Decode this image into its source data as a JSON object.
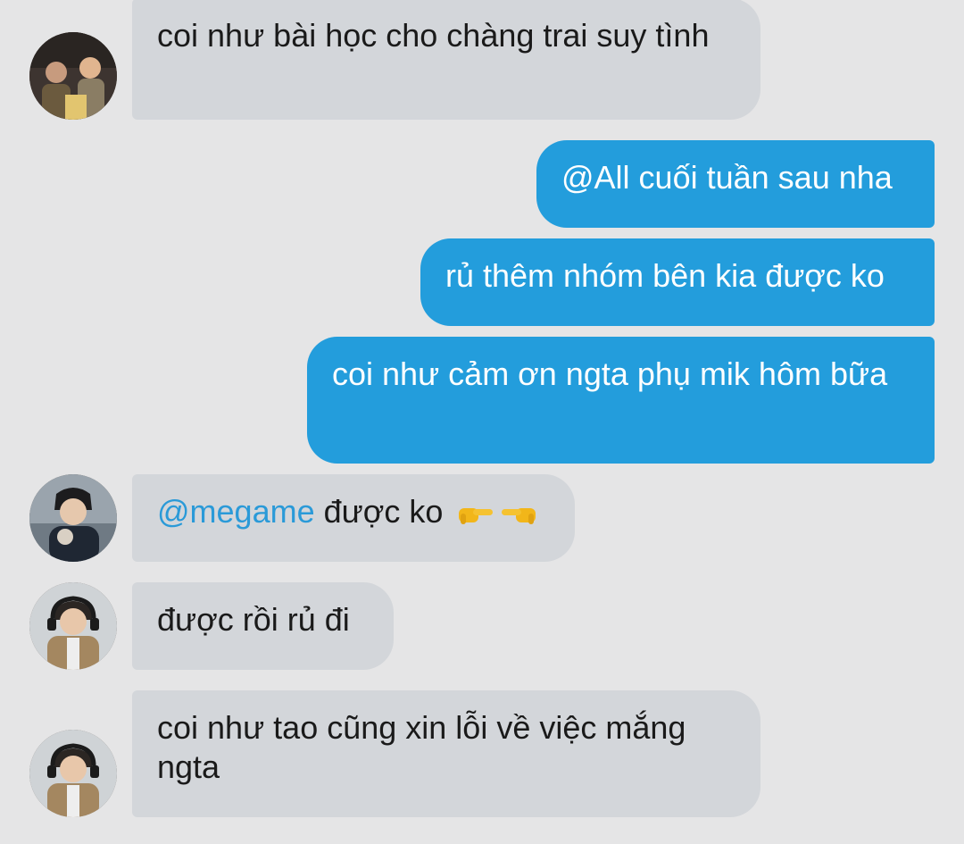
{
  "colors": {
    "background": "#e5e5e6",
    "incoming_bubble": "#d3d6da",
    "outgoing_bubble": "#239ddc",
    "mention": "#2a9ad8"
  },
  "messages": [
    {
      "direction": "incoming",
      "avatar": "avatar-1",
      "text": "coi như bài học cho chàng trai suy tình"
    },
    {
      "direction": "outgoing",
      "text": "@All cuối tuần sau nha"
    },
    {
      "direction": "outgoing",
      "text": "rủ thêm nhóm bên kia được ko"
    },
    {
      "direction": "outgoing",
      "text": "coi như cảm ơn ngta phụ mik hôm bữa"
    },
    {
      "direction": "incoming",
      "avatar": "avatar-2",
      "mention": "@megame",
      "text": " được ko",
      "emoji": [
        "pointing-right-emoji",
        "pointing-left-emoji"
      ]
    },
    {
      "direction": "incoming",
      "avatar": "avatar-3",
      "text": "được rồi rủ đi"
    },
    {
      "direction": "incoming",
      "avatar": "avatar-3",
      "text": "coi như tao cũng xin lỗi về việc mắng ngta"
    }
  ]
}
